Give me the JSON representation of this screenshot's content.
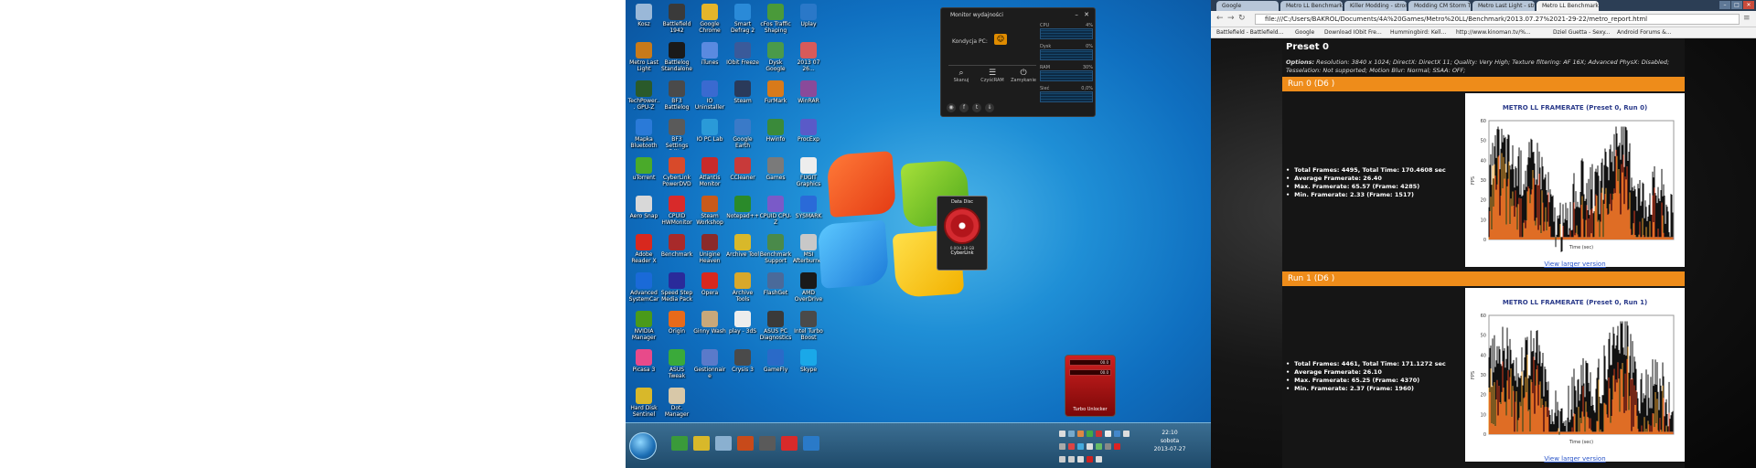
{
  "desktop": {
    "icons": [
      {
        "label": "Kosz",
        "color": "#9ab8d8"
      },
      {
        "label": "Battlefield 1942",
        "color": "#3a3a3a"
      },
      {
        "label": "Google Chrome",
        "color": "#e4b52a"
      },
      {
        "label": "Smart Defrag 2",
        "color": "#2a8ad8"
      },
      {
        "label": "cFos Traffic Shaping",
        "color": "#4a9a3a"
      },
      {
        "label": "Uplay",
        "color": "#2a78c8"
      },
      {
        "label": "Metro Last Light",
        "color": "#c87a1a"
      },
      {
        "label": "Battlelog Standalone",
        "color": "#1a1a1a"
      },
      {
        "label": "iTunes",
        "color": "#5a8ae0"
      },
      {
        "label": "IObit Freeze",
        "color": "#3a5a9a"
      },
      {
        "label": "Dysk Google",
        "color": "#4a9a4a"
      },
      {
        "label": "2013 07 26...",
        "color": "#d85a5a"
      },
      {
        "label": "TechPower... GPU-Z",
        "color": "#2a5a2a"
      },
      {
        "label": "BF3 Battlelog",
        "color": "#4a4a4a"
      },
      {
        "label": "IO Uninstaller",
        "color": "#3a6ad0"
      },
      {
        "label": "Steam",
        "color": "#2a3a5a"
      },
      {
        "label": "FurMark",
        "color": "#d87a1a"
      },
      {
        "label": "WinRAR",
        "color": "#8a4a9a"
      },
      {
        "label": "Mapka Bluetooth",
        "color": "#2a7ad8"
      },
      {
        "label": "BF3 Settings Editor",
        "color": "#5a5a5a"
      },
      {
        "label": "IO PC Lab",
        "color": "#2a9ad8"
      },
      {
        "label": "Google Earth",
        "color": "#3a7ac8"
      },
      {
        "label": "Hwinfo",
        "color": "#3a8a3a"
      },
      {
        "label": "ProcExp",
        "color": "#5a5ac8"
      },
      {
        "label": "uTorrent",
        "color": "#4aaa2a"
      },
      {
        "label": "CyberLink PowerDVD",
        "color": "#d84a2a"
      },
      {
        "label": "Atlantis Monitor",
        "color": "#c82a2a"
      },
      {
        "label": "CCleaner",
        "color": "#c83a3a"
      },
      {
        "label": "Games",
        "color": "#7a7a7a"
      },
      {
        "label": "FUGIT Graphics",
        "color": "#ededed"
      },
      {
        "label": "Aero Snap",
        "color": "#d8d8d8"
      },
      {
        "label": "CPUID HWMonitor",
        "color": "#d82a2a"
      },
      {
        "label": "Steam Workshop",
        "color": "#c85a1a"
      },
      {
        "label": "Notepad++",
        "color": "#2a8a2a"
      },
      {
        "label": "CPUID CPU-Z",
        "color": "#7a5ac8"
      },
      {
        "label": "SYSMARK",
        "color": "#2a6ad8"
      },
      {
        "label": "Adobe Reader X",
        "color": "#d8281e"
      },
      {
        "label": "Benchmark",
        "color": "#a82a2a"
      },
      {
        "label": "Unigine Heaven",
        "color": "#8a2a2a"
      },
      {
        "label": "Archive Tool",
        "color": "#d8b82a"
      },
      {
        "label": "Benchmark Support",
        "color": "#4a8a4a"
      },
      {
        "label": "MSI Afterburner",
        "color": "#c8c8c8"
      },
      {
        "label": "Advanced SystemCare",
        "color": "#1a6ad8"
      },
      {
        "label": "Speed Step Media Pack",
        "color": "#2a2a9a"
      },
      {
        "label": "Opera",
        "color": "#d8281e"
      },
      {
        "label": "Archive Tools",
        "color": "#d8a82a"
      },
      {
        "label": "FlashGet",
        "color": "#4a6a9a"
      },
      {
        "label": "AMD OverDrive",
        "color": "#1a1a1a"
      },
      {
        "label": "NVIDIA Manager",
        "color": "#4a9a1a"
      },
      {
        "label": "Origin",
        "color": "#e86a1a"
      },
      {
        "label": "Ginny Wash",
        "color": "#c8a87a"
      },
      {
        "label": "play - 3dS",
        "color": "#ededed"
      },
      {
        "label": "ASUS PC Diagnostics",
        "color": "#3a3a3a"
      },
      {
        "label": "Intel Turbo Boost",
        "color": "#4a4a4a"
      },
      {
        "label": "Picasa 3",
        "color": "#e84a8a"
      },
      {
        "label": "ASUS Tweak",
        "color": "#3aaa3a"
      },
      {
        "label": "Gestionnaire",
        "color": "#5a7aca"
      },
      {
        "label": "Crysis 3",
        "color": "#4a4a4a"
      },
      {
        "label": "GameFly",
        "color": "#2a6ac8"
      },
      {
        "label": "Skype",
        "color": "#1aa8e8"
      },
      {
        "label": "Hard Disk Sentinel",
        "color": "#d8b82a"
      },
      {
        "label": "Dot. Manager",
        "color": "#d8c8a8"
      }
    ],
    "monitor": {
      "title": "Monitor wydajności",
      "condition_label": "Kondycja PC:",
      "actions": [
        {
          "icon": "⌕",
          "label": "Skanuj"
        },
        {
          "icon": "☰",
          "label": "CzyśćRAM"
        },
        {
          "icon": "⏻",
          "label": "Zamykanie"
        }
      ],
      "meters": [
        {
          "label": "CPU",
          "value": "4%"
        },
        {
          "label": "Dysk",
          "value": "0%"
        },
        {
          "label": "RAM",
          "value": "30%"
        },
        {
          "label": "Sieć",
          "value": "0,0%"
        }
      ],
      "social": [
        "◉",
        "f",
        "t",
        "⇓"
      ]
    },
    "datadisc": {
      "title": "Data Disc",
      "sub": "0.00/4.38 GB",
      "label": "CyberLink"
    },
    "turbo": {
      "rows": [
        "00.0",
        "00.0"
      ],
      "label": "Turbo Unlocker"
    },
    "clock": {
      "time": "22:10",
      "day": "sobota",
      "date": "2013-07-27"
    }
  },
  "browser": {
    "tabs": [
      "Google",
      "Metro LL Benchmark Re...",
      "Killer Modding - strona...",
      "Modding CM Storm Tro...",
      "Metro Last Light - strona...",
      "Metro LL Benchmark Re..."
    ],
    "active_tab": 5,
    "address": "file:///C:/Users/BAKROL/Documents/4A%20Games/Metro%20LL/Benchmark/2013.07.27%2021-29-22/metro_report.html",
    "bookmarks": [
      "Battlefield - Battlefield...",
      "Google",
      "Download IObit Fre...",
      "Hummingbird: Kell...",
      "http://www.kinoman.tv/%...",
      "Dziel Guetta - Sexy...",
      "Android Forums &..."
    ],
    "report": {
      "preset_title": "Preset 0",
      "options_label": "Options:",
      "options_text": "Resolution: 3840 x 1024; DirectX: DirectX 11; Quality: Very High; Texture filtering: AF 16X; Advanced PhysX: Disabled; Tesselation: Not supported; Motion Blur: Normal; SSAA: OFF;",
      "runs": [
        {
          "title": "Run 0 (D6 )",
          "stats": [
            "Total Frames: 4495, Total Time: 170.4608 sec",
            "Average Framerate: 26.40",
            "Max. Framerate: 65.57 (Frame: 4285)",
            "Min. Framerate: 2.33 (Frame: 1517)"
          ],
          "chart_title": "METRO LL FRAMERATE (Preset 0, Run 0)",
          "link": "View larger version"
        },
        {
          "title": "Run 1 (D6 )",
          "stats": [
            "Total Frames: 4461, Total Time: 171.1272 sec",
            "Average Framerate: 26.10",
            "Max. Framerate: 65.25 (Frame: 4370)",
            "Min. Framerate: 2.37 (Frame: 1960)"
          ],
          "chart_title": "METRO LL FRAMERATE (Preset 0, Run 1)",
          "link": "View larger version"
        }
      ],
      "chart_axis": {
        "ylabel": "FPS",
        "xlabel": "Time (sec)",
        "yticks": [
          "60",
          "50",
          "40",
          "30",
          "20",
          "10",
          "0"
        ]
      }
    }
  }
}
